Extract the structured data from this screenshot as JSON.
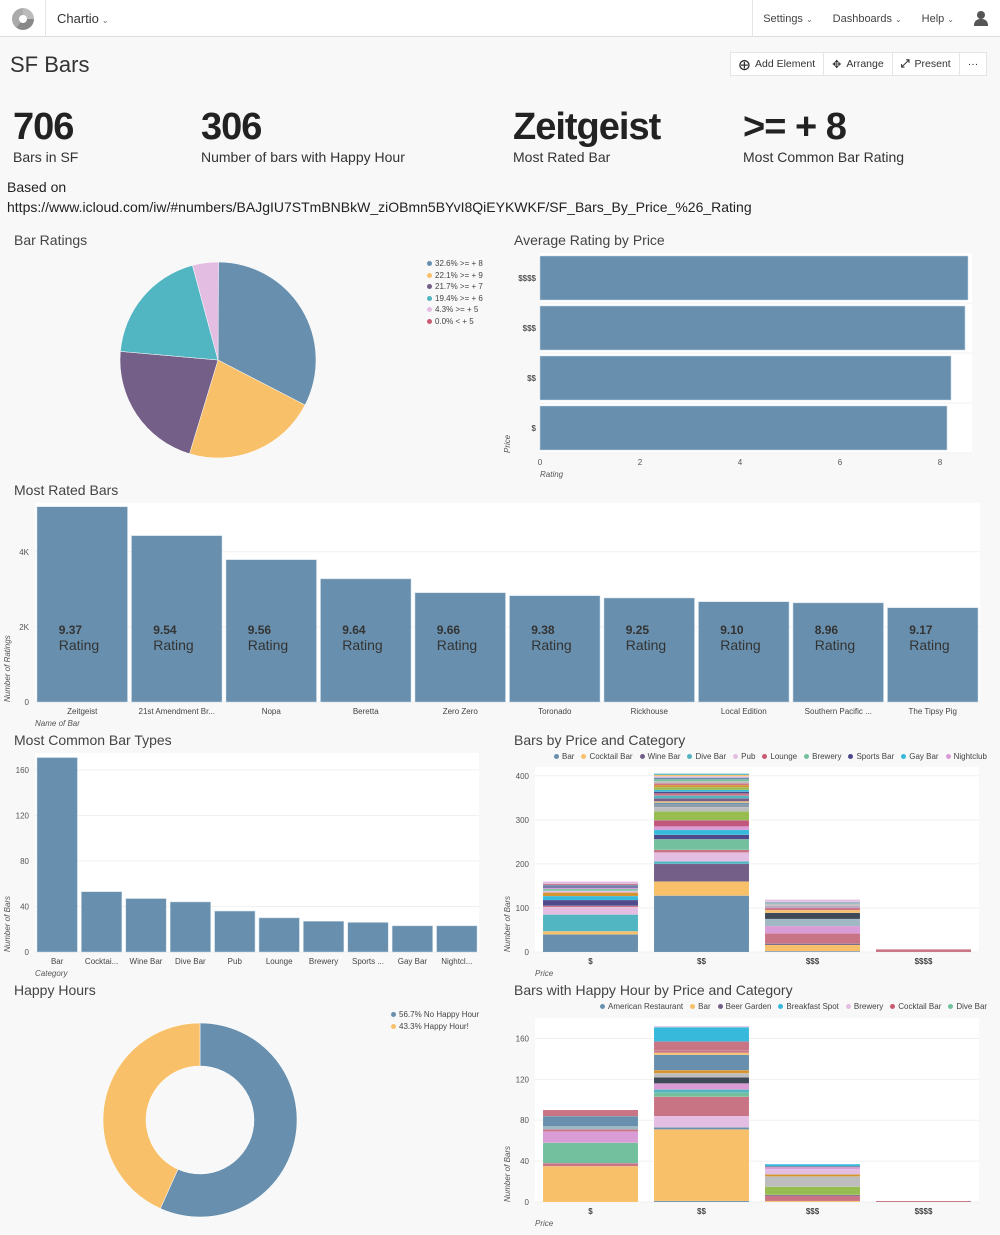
{
  "app": {
    "brand": "Chartio",
    "nav": [
      "Settings",
      "Dashboards",
      "Help"
    ],
    "icons": {
      "logo": "chartio-logo-icon",
      "user": "user-icon"
    }
  },
  "dashboard": {
    "title": "SF Bars",
    "toolbar": {
      "add_element": "Add Element",
      "arrange": "Arrange",
      "present": "Present",
      "more": "···"
    }
  },
  "kpis": [
    {
      "value": "706",
      "label": "Bars in SF"
    },
    {
      "value": "306",
      "label": "Number of bars with Happy Hour"
    },
    {
      "value": "Zeitgeist",
      "label": "Most Rated Bar"
    },
    {
      "value": ">= + 8",
      "label": "Most Common Bar Rating"
    }
  ],
  "based_on": {
    "label": "Based on",
    "url": "https://www.icloud.com/iw/#numbers/BAJgIU7STmBNBkW_ziOBmn5BYvI8QiEYKWKF/SF_Bars_By_Price_%26_Rating"
  },
  "colors": {
    "primary": "#6890AE",
    "orange": "#F9C06A",
    "purple": "#735F87",
    "teal": "#52B5C2",
    "pink": "#E4BDE3",
    "red": "#C95A6F"
  },
  "chart_data": [
    {
      "id": "bar-ratings",
      "type": "pie",
      "title": "Bar Ratings",
      "legend_position": "top-right",
      "slices": [
        {
          "label": ">= + 8",
          "pct": 32.6,
          "legend": "32.6% >= + 8",
          "color": "#6890AE"
        },
        {
          "label": ">= + 9",
          "pct": 22.1,
          "legend": "22.1% >= + 9",
          "color": "#F9C06A"
        },
        {
          "label": ">= + 7",
          "pct": 21.7,
          "legend": "21.7% >= + 7",
          "color": "#735F87"
        },
        {
          "label": ">= + 6",
          "pct": 19.4,
          "legend": "19.4% >= + 6",
          "color": "#52B5C2"
        },
        {
          "label": ">= + 5",
          "pct": 4.3,
          "legend": "4.3% >= + 5",
          "color": "#E4BDE3"
        },
        {
          "label": "< + 5",
          "pct": 0.0,
          "legend": "0.0% < + 5",
          "color": "#C95A6F"
        }
      ]
    },
    {
      "id": "avg-rating-by-price",
      "type": "bar",
      "orientation": "horizontal",
      "title": "Average Rating by Price",
      "xlabel": "Rating",
      "ylabel": "Price",
      "categories": [
        "$$$$",
        "$$$",
        "$$",
        "$"
      ],
      "values": [
        8.56,
        8.5,
        8.22,
        8.14
      ],
      "xlim": [
        0,
        8.6
      ],
      "xticks": [
        0,
        2,
        4,
        6,
        8
      ],
      "grid": true
    },
    {
      "id": "most-rated-bars",
      "type": "bar",
      "title": "Most Rated Bars",
      "xlabel": "Name of Bar",
      "ylabel": "Number of Ratings",
      "categories": [
        "Zeitgeist",
        "21st Amendment Br...",
        "Nopa",
        "Beretta",
        "Zero Zero",
        "Toronado",
        "Rickhouse",
        "Local Edition",
        "Southern Pacific ...",
        "The Tipsy Pig"
      ],
      "values": [
        5200,
        4430,
        3790,
        3280,
        2910,
        2830,
        2770,
        2670,
        2640,
        2510
      ],
      "data_labels": [
        "9.37",
        "9.54",
        "9.56",
        "9.64",
        "9.66",
        "9.38",
        "9.25",
        "9.10",
        "8.96",
        "9.17"
      ],
      "data_label_suffix": "Rating",
      "ylim": [
        0,
        5300
      ],
      "yticks": [
        {
          "v": 0,
          "label": "0"
        },
        {
          "v": 2000,
          "label": "2K"
        },
        {
          "v": 4000,
          "label": "4K"
        }
      ],
      "grid": true
    },
    {
      "id": "most-common-bar-types",
      "type": "bar",
      "title": "Most Common Bar Types",
      "xlabel": "Category",
      "ylabel": "Number of Bars",
      "categories": [
        "Bar",
        "Cocktai...",
        "Wine Bar",
        "Dive Bar",
        "Pub",
        "Lounge",
        "Brewery",
        "Sports ...",
        "Gay Bar",
        "Nightcl..."
      ],
      "values": [
        171,
        53,
        47,
        44,
        36,
        30,
        27,
        26,
        23,
        23
      ],
      "ylim": [
        0,
        175
      ],
      "yticks": [
        0,
        40,
        80,
        120,
        160
      ],
      "grid": true
    },
    {
      "id": "bars-by-price-category",
      "type": "bar",
      "stacked": true,
      "title": "Bars by Price and Category",
      "xlabel": "Price",
      "ylabel": "Number of Bars",
      "categories": [
        "$",
        "$$",
        "$$$",
        "$$$$"
      ],
      "legend_position": "top",
      "legend": [
        {
          "name": "Bar",
          "color": "#6890AE"
        },
        {
          "name": "Cocktail Bar",
          "color": "#F9C06A"
        },
        {
          "name": "Wine Bar",
          "color": "#735F87"
        },
        {
          "name": "Dive Bar",
          "color": "#52B5C2"
        },
        {
          "name": "Pub",
          "color": "#E4BDE3"
        },
        {
          "name": "Lounge",
          "color": "#C95A6F"
        },
        {
          "name": "Brewery",
          "color": "#72C09E"
        },
        {
          "name": "Sports Bar",
          "color": "#4E4A8C"
        },
        {
          "name": "Gay Bar",
          "color": "#36B9DA"
        },
        {
          "name": "Nightclub",
          "color": "#D99CD6"
        }
      ],
      "totals": [
        162,
        414,
        119,
        6
      ],
      "stacks": [
        [
          [
            40,
            "#6890AE"
          ],
          [
            7,
            "#F9C06A"
          ],
          [
            38,
            "#52B5C2"
          ],
          [
            17,
            "#E4BDE3"
          ],
          [
            3,
            "#C97485"
          ],
          [
            13,
            "#4E4A8C"
          ],
          [
            9,
            "#36B9DA"
          ],
          [
            8,
            "#D4952E"
          ],
          [
            4,
            "#E4BDE3"
          ],
          [
            4,
            "#72C09E"
          ],
          [
            3,
            "#D99CD6"
          ],
          [
            3,
            "#4E4A8C"
          ],
          [
            3,
            "#6890AE"
          ],
          [
            3,
            "#C97485"
          ],
          [
            5,
            "#E4BDE3"
          ]
        ],
        [
          [
            128,
            "#6890AE"
          ],
          [
            32,
            "#F9C06A"
          ],
          [
            40,
            "#735F87"
          ],
          [
            6,
            "#52B5C2"
          ],
          [
            20,
            "#E4BDE3"
          ],
          [
            6,
            "#C97485"
          ],
          [
            24,
            "#72C09E"
          ],
          [
            10,
            "#4E4A8C"
          ],
          [
            11,
            "#36B9DA"
          ],
          [
            8,
            "#D99CD6"
          ],
          [
            14,
            "#C2577E"
          ],
          [
            20,
            "#97BC4F"
          ],
          [
            10,
            "#BDBDBD"
          ],
          [
            6,
            "#8A9AAA"
          ],
          [
            4,
            "#6890AE"
          ],
          [
            3,
            "#F9C06A"
          ],
          [
            7,
            "#735F87"
          ],
          [
            6,
            "#52B5C2"
          ],
          [
            5,
            "#C97485"
          ],
          [
            4,
            "#4E4A8C"
          ],
          [
            4,
            "#36B9DA"
          ],
          [
            6,
            "#97BC4F"
          ],
          [
            5,
            "#D4952E"
          ],
          [
            4,
            "#C97485"
          ],
          [
            5,
            "#BDBDBD"
          ],
          [
            4,
            "#72C09E"
          ],
          [
            4,
            "#6890AE"
          ],
          [
            3,
            "#E4BDE3"
          ],
          [
            3,
            "#F9C06A"
          ],
          [
            3,
            "#52B5C2"
          ]
        ],
        [
          [
            2,
            "#6890AE"
          ],
          [
            14,
            "#F9C06A"
          ],
          [
            3,
            "#735F87"
          ],
          [
            23,
            "#C97485"
          ],
          [
            17,
            "#D99CD6"
          ],
          [
            16,
            "#A0B8C4"
          ],
          [
            14,
            "#3F4A58"
          ],
          [
            6,
            "#F9C06A"
          ],
          [
            5,
            "#C97485"
          ],
          [
            5,
            "#B7A6C4"
          ],
          [
            4,
            "#BDBDBD"
          ],
          [
            5,
            "#A0B8C4"
          ],
          [
            5,
            "#E4BDE3"
          ]
        ],
        [
          [
            6,
            "#C97485"
          ]
        ]
      ],
      "ylim": [
        0,
        420
      ],
      "yticks": [
        0,
        100,
        200,
        300,
        400
      ],
      "grid": true
    },
    {
      "id": "happy-hours",
      "type": "pie",
      "donut": true,
      "title": "Happy Hours",
      "legend_position": "top-right",
      "slices": [
        {
          "label": "No Happy Hour",
          "pct": 56.7,
          "legend": "56.7% No Happy Hour",
          "color": "#6890AE"
        },
        {
          "label": "Happy Hour!",
          "pct": 43.3,
          "legend": "43.3% Happy Hour!",
          "color": "#F9C06A"
        }
      ]
    },
    {
      "id": "happy-hour-by-price-category",
      "type": "bar",
      "stacked": true,
      "title": "Bars with Happy Hour by Price and Category",
      "xlabel": "Price",
      "ylabel": "Number of Bars",
      "categories": [
        "$",
        "$$",
        "$$$",
        "$$$$"
      ],
      "legend_position": "top",
      "legend": [
        {
          "name": "American Restaurant",
          "color": "#6890AE"
        },
        {
          "name": "Bar",
          "color": "#F9C06A"
        },
        {
          "name": "Beer Garden",
          "color": "#735F87"
        },
        {
          "name": "Breakfast Spot",
          "color": "#36B9DA"
        },
        {
          "name": "Brewery",
          "color": "#E4BDE3"
        },
        {
          "name": "Cocktail Bar",
          "color": "#C95A6F"
        },
        {
          "name": "Dive Bar",
          "color": "#72C09E"
        }
      ],
      "totals": [
        90,
        177,
        37,
        1
      ],
      "stacks": [
        [
          [
            35,
            "#F9C06A"
          ],
          [
            3,
            "#C97485"
          ],
          [
            20,
            "#72C09E"
          ],
          [
            11,
            "#D99CD6"
          ],
          [
            2,
            "#C97485"
          ],
          [
            3,
            "#A0B8C4"
          ],
          [
            10,
            "#6890AE"
          ],
          [
            6,
            "#C97485"
          ]
        ],
        [
          [
            1,
            "#6890AE"
          ],
          [
            70,
            "#F9C06A"
          ],
          [
            2,
            "#6890AE"
          ],
          [
            11,
            "#E4BDE3"
          ],
          [
            19,
            "#C97485"
          ],
          [
            4,
            "#72C09E"
          ],
          [
            3,
            "#52B5C2"
          ],
          [
            6,
            "#D99CD6"
          ],
          [
            6,
            "#3F4A58"
          ],
          [
            4,
            "#BDBDBD"
          ],
          [
            3,
            "#D4952E"
          ],
          [
            15,
            "#6890AE"
          ],
          [
            2,
            "#F9C06A"
          ],
          [
            2,
            "#C97485"
          ],
          [
            9,
            "#C97485"
          ],
          [
            14,
            "#36B9DA"
          ],
          [
            1,
            "#E4BDE3"
          ]
        ],
        [
          [
            1,
            "#F9C06A"
          ],
          [
            5,
            "#C97485"
          ],
          [
            1,
            "#735F87"
          ],
          [
            8,
            "#97BC4F"
          ],
          [
            10,
            "#BDBDBD"
          ],
          [
            2,
            "#D4952E"
          ],
          [
            5,
            "#E4BDE3"
          ],
          [
            2,
            "#D99CD6"
          ],
          [
            1,
            "#735F87"
          ],
          [
            2,
            "#36B9DA"
          ]
        ],
        [
          [
            1,
            "#C97485"
          ]
        ]
      ],
      "ylim": [
        0,
        180
      ],
      "yticks": [
        0,
        40,
        80,
        120,
        160
      ],
      "grid": true
    }
  ]
}
